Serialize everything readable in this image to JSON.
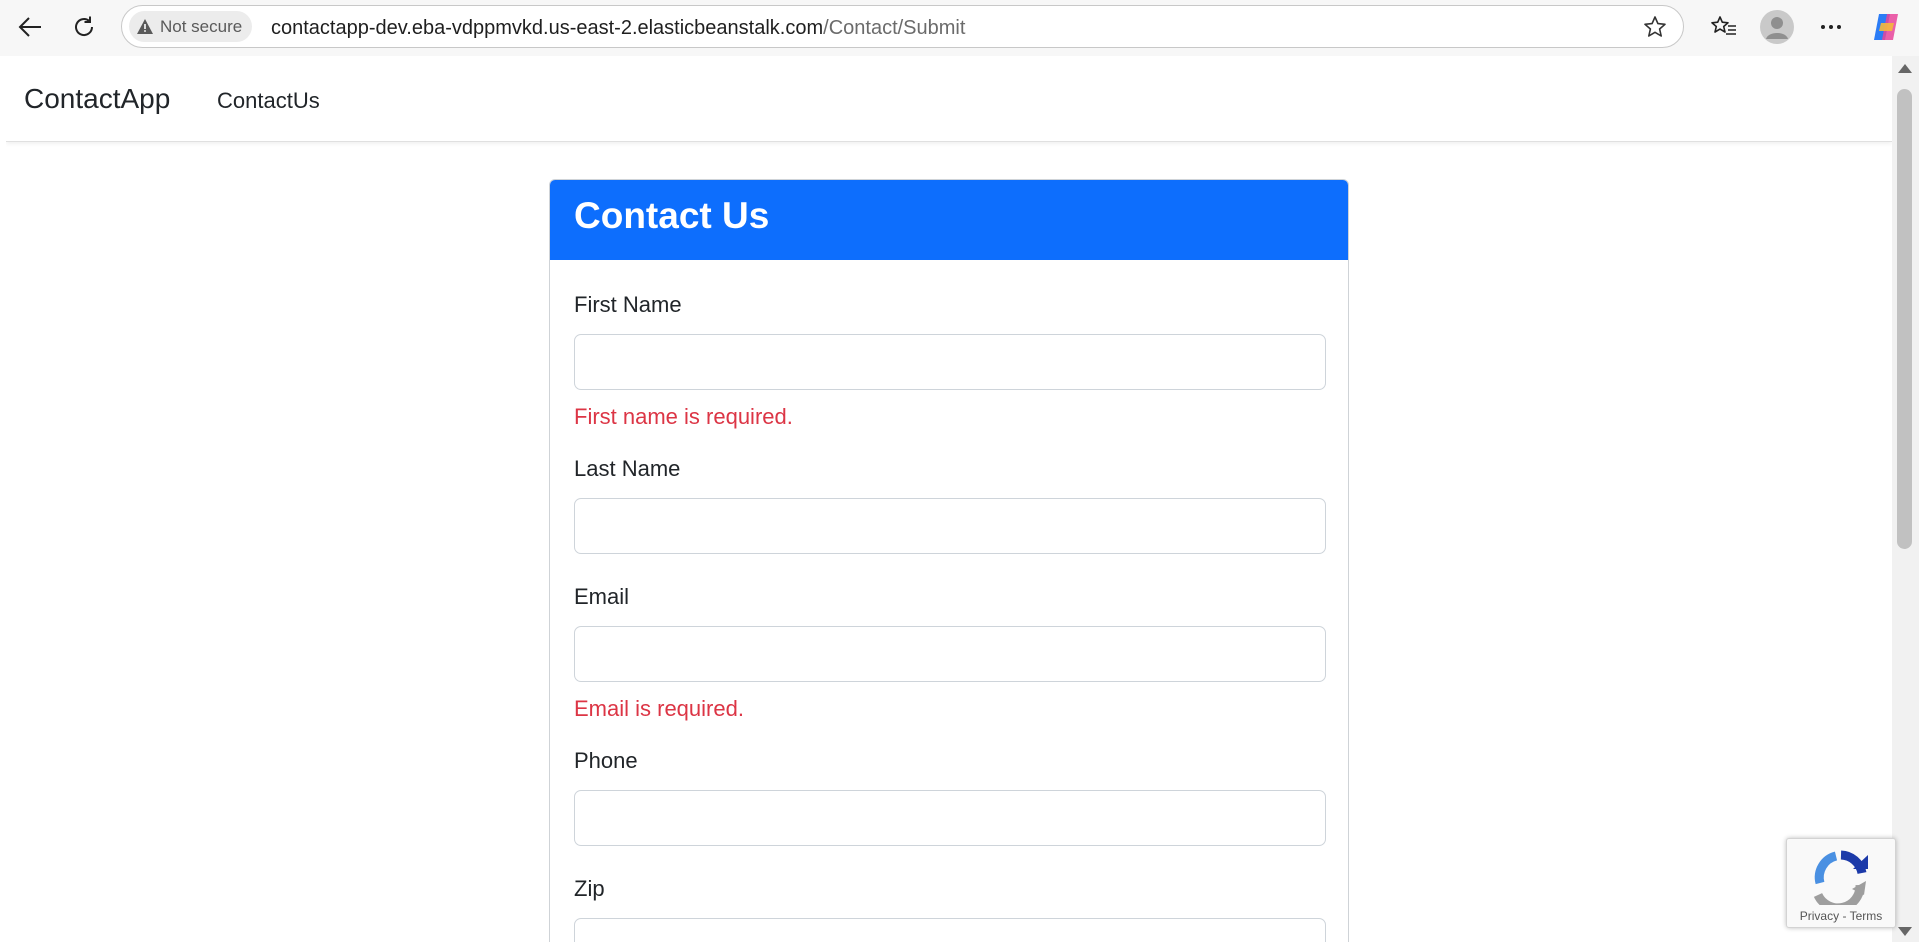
{
  "browser": {
    "security_label": "Not secure",
    "url_host": "contactapp-dev.eba-vdppmvkd.us-east-2.elasticbeanstalk.com",
    "url_path": "/Contact/Submit",
    "icons": [
      "back-icon",
      "refresh-icon",
      "warning-icon",
      "favorite-star-icon",
      "favorites-list-icon",
      "profile-avatar-icon",
      "more-options-icon",
      "copilot-icon"
    ]
  },
  "navbar": {
    "brand": "ContactApp",
    "link": "ContactUs"
  },
  "card": {
    "title": "Contact Us",
    "header_color": "#0d6efd",
    "fields": [
      {
        "label": "First Name",
        "value": "",
        "error": "First name is required."
      },
      {
        "label": "Last Name",
        "value": "",
        "error": ""
      },
      {
        "label": "Email",
        "value": "",
        "error": "Email is required."
      },
      {
        "label": "Phone",
        "value": "",
        "error": ""
      },
      {
        "label": "Zip",
        "value": "",
        "error": ""
      }
    ],
    "error_color": "#dc3545"
  },
  "recaptcha": {
    "privacy": "Privacy",
    "separator": " - ",
    "terms": "Terms"
  }
}
